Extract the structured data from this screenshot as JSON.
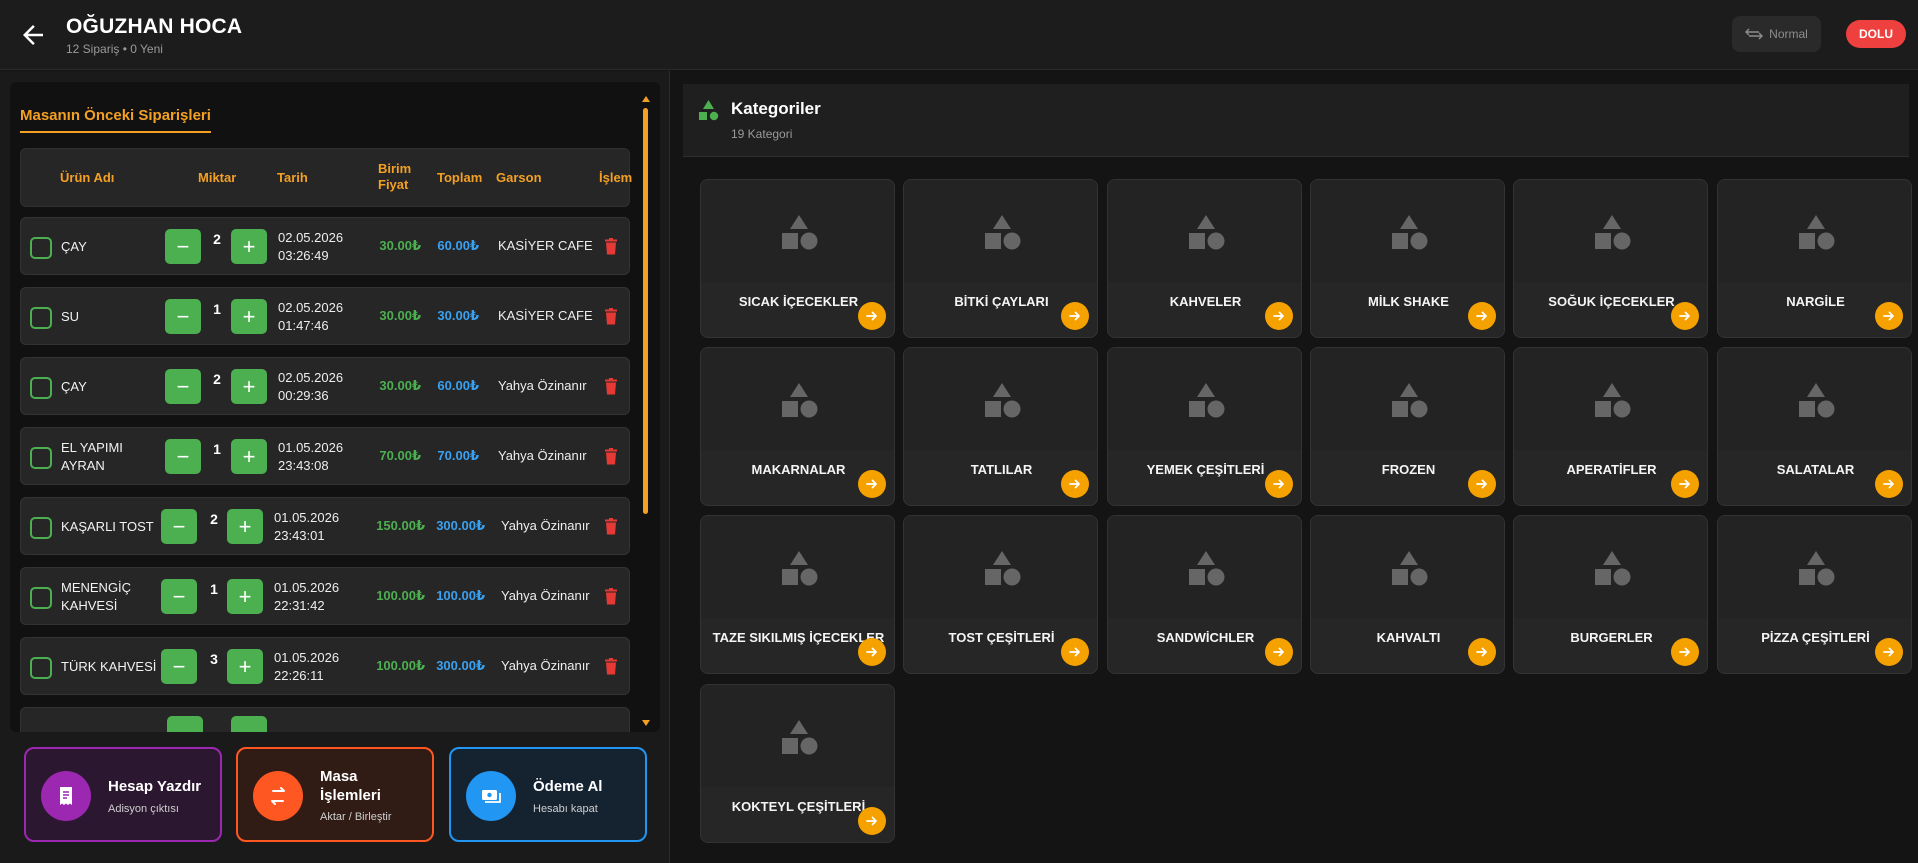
{
  "header": {
    "title": "OĞUZHAN HOCA",
    "subtitle": "12 Sipariş • 0 Yeni",
    "mode_label": "Normal",
    "status_badge": "DOLU",
    "status_color": "#ef4040"
  },
  "orders": {
    "section_title": "Masanın Önceki Siparişleri",
    "columns": {
      "product": "Ürün Adı",
      "quantity": "Miktar",
      "date": "Tarih",
      "unit_price": "Birim Fiyat",
      "total": "Toplam",
      "waiter": "Garson",
      "action": "İşlem"
    },
    "rows": [
      {
        "name": "ÇAY",
        "qty": "2",
        "date": "02.05.2026",
        "time": "03:26:49",
        "price": "30.00₺",
        "total": "60.00₺",
        "waiter": "KASİYER CAFE"
      },
      {
        "name": "SU",
        "qty": "1",
        "date": "02.05.2026",
        "time": "01:47:46",
        "price": "30.00₺",
        "total": "30.00₺",
        "waiter": "KASİYER CAFE"
      },
      {
        "name": "ÇAY",
        "qty": "2",
        "date": "02.05.2026",
        "time": "00:29:36",
        "price": "30.00₺",
        "total": "60.00₺",
        "waiter": "Yahya Özinanır"
      },
      {
        "name": "EL YAPIMI AYRAN",
        "qty": "1",
        "date": "01.05.2026",
        "time": "23:43:08",
        "price": "70.00₺",
        "total": "70.00₺",
        "waiter": "Yahya Özinanır"
      },
      {
        "name": "KAŞARLI TOST",
        "qty": "2",
        "date": "01.05.2026",
        "time": "23:43:01",
        "price": "150.00₺",
        "total": "300.00₺",
        "waiter": "Yahya Özinanır"
      },
      {
        "name": "MENENGİÇ KAHVESİ",
        "qty": "1",
        "date": "01.05.2026",
        "time": "22:31:42",
        "price": "100.00₺",
        "total": "100.00₺",
        "waiter": "Yahya Özinanır"
      },
      {
        "name": "TÜRK KAHVESİ",
        "qty": "3",
        "date": "01.05.2026",
        "time": "22:26:11",
        "price": "100.00₺",
        "total": "300.00₺",
        "waiter": "Yahya Özinanır"
      }
    ],
    "minus_symbol": "−",
    "plus_symbol": "+"
  },
  "actions": {
    "print": {
      "title": "Hesap Yazdır",
      "subtitle": "Adisyon çıktısı",
      "color": "#9c27b0"
    },
    "table": {
      "title": "Masa İşlemleri",
      "subtitle": "Aktar / Birleştir",
      "color": "#ff5722"
    },
    "payment": {
      "title": "Ödeme Al",
      "subtitle": "Hesabı kapat",
      "color": "#2196f3"
    }
  },
  "categories": {
    "title": "Kategoriler",
    "count": "19 Kategori",
    "items": [
      "SICAK İÇECEKLER",
      "BİTKİ ÇAYLARI",
      "KAHVELER",
      "MİLK SHAKE",
      "SOĞUK İÇECEKLER",
      "NARGİLE",
      "MAKARNALAR",
      "TATLILAR",
      "YEMEK ÇEŞİTLERİ",
      "FROZEN",
      "APERATİFLER",
      "SALATALAR",
      "TAZE SIKILMIŞ İÇECEKLER",
      "TOST ÇEŞİTLERİ",
      "SANDWİCHLER",
      "KAHVALTI",
      "BURGERLER",
      "PİZZA ÇEŞİTLERİ",
      "KOKTEYL ÇEŞİTLERİ"
    ]
  },
  "colors": {
    "accent": "#f4a024",
    "green": "#4caf50",
    "blue": "#3aa0f0"
  }
}
